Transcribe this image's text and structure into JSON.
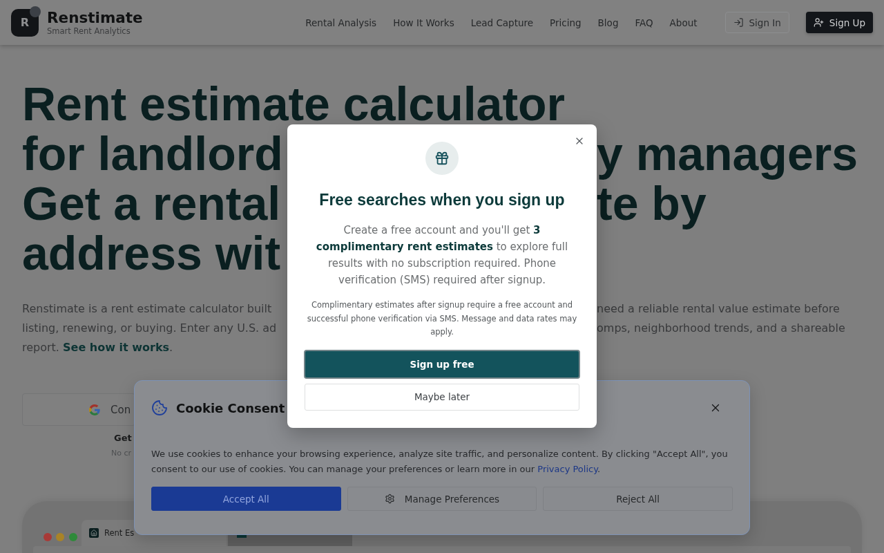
{
  "header": {
    "logo": {
      "letter": "R",
      "name": "Renstimate",
      "tagline": "Smart Rent Analytics"
    },
    "nav": [
      "Rental Analysis",
      "How It Works",
      "Lead Capture",
      "Pricing",
      "Blog",
      "FAQ",
      "About"
    ],
    "sign_in": "Sign In",
    "sign_up": "Sign Up"
  },
  "hero": {
    "title_lines": [
      {
        "left": "Rent estimate calculator"
      },
      {
        "left": "for landlord",
        "right": "y managers"
      },
      {
        "left": "Get a rental",
        "right": "te by"
      },
      {
        "left": "address wit"
      }
    ],
    "intro_lines": [
      {
        "left": "Renstimate is a rent estimate calculator built",
        "right": "need a reliable rental value estimate before"
      },
      {
        "left": "listing, renewing, or buying. Enter any U.S. ad",
        "right": "omps, neighborhood trends, and a shareable"
      }
    ],
    "intro_end": {
      "text": "report.",
      "link": "See how it works",
      "after": "."
    },
    "google_button": "Con",
    "cta_title": "Get",
    "cta_note": "No cr"
  },
  "preview": {
    "tabs": [
      {
        "label": "Rent Es",
        "selected": true
      },
      {
        "selected": false
      }
    ]
  },
  "cookie_banner": {
    "title": "Cookie Consent",
    "text": "We use cookies to enhance your browsing experience, analyze site traffic, and personalize content. By clicking \"Accept All\", you consent to our use of cookies. You can manage your preferences or learn more in our",
    "link": "Privacy Policy",
    "after": ".",
    "buttons": [
      {
        "kind": "primary",
        "label": "Accept All"
      },
      {
        "kind": "settings",
        "label": "Manage Preferences"
      },
      {
        "kind": "outline",
        "label": "Reject All"
      }
    ]
  },
  "modal": {
    "title": "Free searches when you sign up",
    "body": "Create a free account and you'll get **3 complimentary rent estimates** to explore full results with no subscription required. Phone verification (SMS) required after signup.",
    "fine_print": "Complimentary estimates after signup require a free account and successful phone verification via SMS. Message and data rates may apply.",
    "primary": "Sign up free",
    "secondary": "Maybe later"
  }
}
